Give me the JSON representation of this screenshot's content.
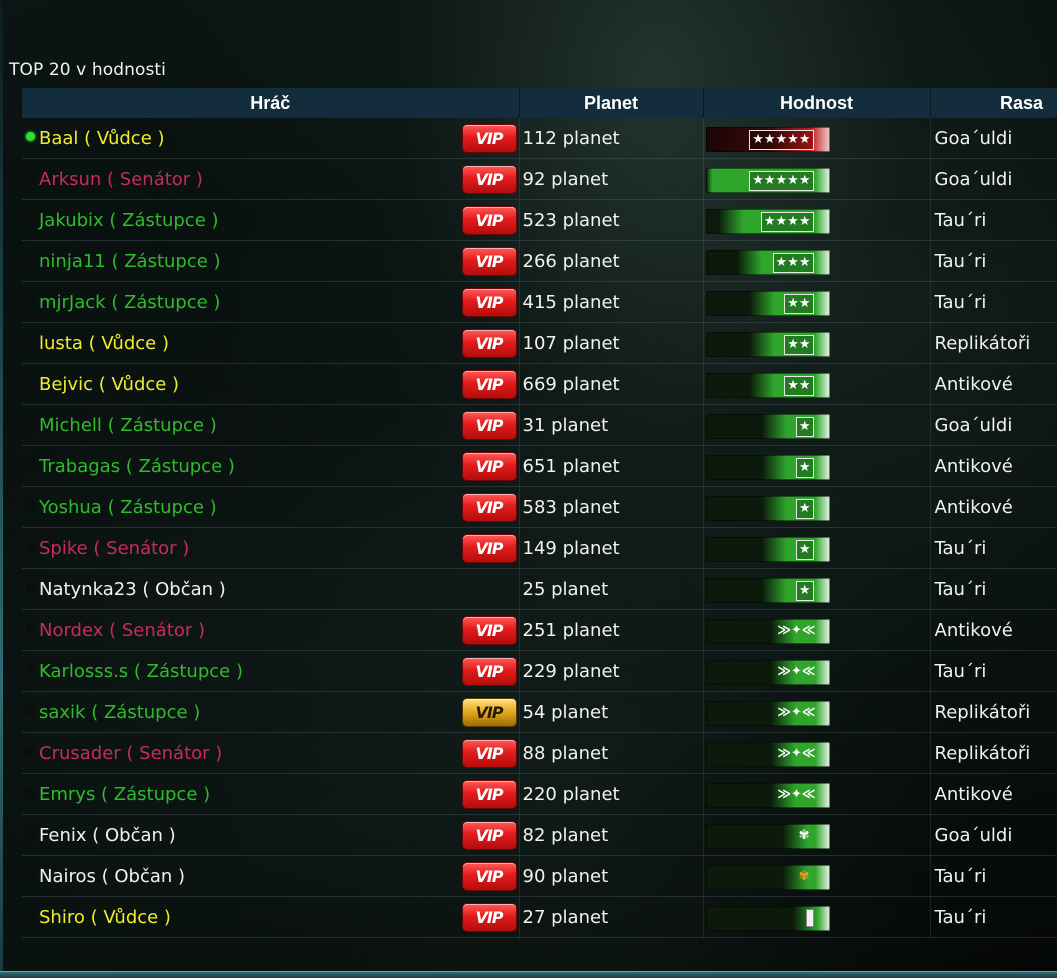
{
  "title": "TOP 20 v hodnosti",
  "columns": {
    "player": "Hráč",
    "planets": "Planet",
    "rank": "Hodnost",
    "race": "Rasa"
  },
  "colors": {
    "vudce": "#f1ec2c",
    "senator": "#c72a63",
    "zastupce": "#2fbc2b",
    "obcan": "#f2f2f2",
    "header": "#132d3c",
    "online": "#2fe02b"
  },
  "rows": [
    {
      "name": "Baal ( Vůdce )",
      "role": "vudce",
      "online": true,
      "vip": "red",
      "planets": "112 planet",
      "insignia": "★★★★★",
      "insignia_icon": "five-star-insignia-icon",
      "race": "Goa´uldi",
      "bar_fill": 0.0
    },
    {
      "name": "Arksun ( Senátor )",
      "role": "senator",
      "online": false,
      "vip": "red",
      "planets": "92 planet",
      "insignia": "★★★★★",
      "insignia_icon": "five-star-insignia-icon",
      "race": "Goa´uldi",
      "bar_fill": 0.05
    },
    {
      "name": "Jakubix ( Zástupce )",
      "role": "zastupce",
      "online": false,
      "vip": "red",
      "planets": "523 planet",
      "insignia": "★★★★",
      "insignia_icon": "four-star-insignia-icon",
      "race": "Tau´ri",
      "bar_fill": 0.3
    },
    {
      "name": "ninja11 ( Zástupce )",
      "role": "zastupce",
      "online": false,
      "vip": "red",
      "planets": "266 planet",
      "insignia": "★★★",
      "insignia_icon": "three-star-insignia-icon",
      "race": "Tau´ri",
      "bar_fill": 0.45
    },
    {
      "name": "mjrJack ( Zástupce )",
      "role": "zastupce",
      "online": false,
      "vip": "red",
      "planets": "415 planet",
      "insignia": "★★",
      "insignia_icon": "two-star-insignia-icon",
      "race": "Tau´ri",
      "bar_fill": 0.55
    },
    {
      "name": "lusta ( Vůdce )",
      "role": "vudce",
      "online": false,
      "vip": "red",
      "planets": "107 planet",
      "insignia": "★★",
      "insignia_icon": "two-star-insignia-icon",
      "race": "Replikátoři",
      "bar_fill": 0.55
    },
    {
      "name": "Bejvic ( Vůdce )",
      "role": "vudce",
      "online": false,
      "vip": "red",
      "planets": "669 planet",
      "insignia": "★★",
      "insignia_icon": "two-star-insignia-icon",
      "race": "Antikové",
      "bar_fill": 0.55
    },
    {
      "name": "Michell ( Zástupce )",
      "role": "zastupce",
      "online": false,
      "vip": "red",
      "planets": "31 planet",
      "insignia": "★",
      "insignia_icon": "one-star-insignia-icon",
      "race": "Goa´uldi",
      "bar_fill": 0.65
    },
    {
      "name": "Trabagas ( Zástupce )",
      "role": "zastupce",
      "online": false,
      "vip": "red",
      "planets": "651 planet",
      "insignia": "★",
      "insignia_icon": "one-star-insignia-icon",
      "race": "Antikové",
      "bar_fill": 0.65
    },
    {
      "name": "Yoshua ( Zástupce )",
      "role": "zastupce",
      "online": false,
      "vip": "red",
      "planets": "583 planet",
      "insignia": "★",
      "insignia_icon": "one-star-insignia-icon",
      "race": "Antikové",
      "bar_fill": 0.65
    },
    {
      "name": "Spike ( Senátor )",
      "role": "senator",
      "online": false,
      "vip": "red",
      "planets": "149 planet",
      "insignia": "★",
      "insignia_icon": "one-star-insignia-icon",
      "race": "Tau´ri",
      "bar_fill": 0.65
    },
    {
      "name": "Natynka23 ( Občan )",
      "role": "obcan",
      "online": false,
      "vip": "",
      "planets": "25 planet",
      "insignia": "★",
      "insignia_icon": "one-star-insignia-icon",
      "race": "Tau´ri",
      "bar_fill": 0.65
    },
    {
      "name": "Nordex ( Senátor )",
      "role": "senator",
      "online": false,
      "vip": "red",
      "planets": "251 planet",
      "insignia": "≫✦≪",
      "insignia_icon": "winged-insignia-icon",
      "race": "Antikové",
      "bar_fill": 0.72
    },
    {
      "name": "Karlosss.s ( Zástupce )",
      "role": "zastupce",
      "online": false,
      "vip": "red",
      "planets": "229 planet",
      "insignia": "≫✦≪",
      "insignia_icon": "winged-insignia-icon",
      "race": "Tau´ri",
      "bar_fill": 0.72
    },
    {
      "name": "saxik ( Zástupce )",
      "role": "zastupce",
      "online": false,
      "vip": "gold",
      "planets": "54 planet",
      "insignia": "≫✦≪",
      "insignia_icon": "winged-insignia-icon",
      "race": "Replikátoři",
      "bar_fill": 0.72
    },
    {
      "name": "Crusader ( Senátor )",
      "role": "senator",
      "online": false,
      "vip": "red",
      "planets": "88 planet",
      "insignia": "≫✦≪",
      "insignia_icon": "winged-insignia-icon",
      "race": "Replikátoři",
      "bar_fill": 0.72
    },
    {
      "name": "Emrys ( Zástupce )",
      "role": "zastupce",
      "online": false,
      "vip": "red",
      "planets": "220 planet",
      "insignia": "≫✦≪",
      "insignia_icon": "winged-insignia-icon",
      "race": "Antikové",
      "bar_fill": 0.72
    },
    {
      "name": "Fenix ( Občan )",
      "role": "obcan",
      "online": false,
      "vip": "red",
      "planets": "82 planet",
      "insignia": "✾",
      "insignia_icon": "silver-leaf-insignia-icon",
      "race": "Goa´uldi",
      "bar_fill": 0.82
    },
    {
      "name": "Nairos ( Občan )",
      "role": "obcan",
      "online": false,
      "vip": "red",
      "planets": "90 planet",
      "insignia": "✾",
      "insignia_icon": "gold-leaf-insignia-icon",
      "race": "Tau´ri",
      "bar_fill": 0.82
    },
    {
      "name": "Shiro ( Vůdce )",
      "role": "vudce",
      "online": false,
      "vip": "red",
      "planets": "27 planet",
      "insignia": "",
      "insignia_icon": "bar-insignia-icon",
      "race": "Tau´ri",
      "bar_fill": 0.9
    }
  ],
  "vip_label": "VIP"
}
